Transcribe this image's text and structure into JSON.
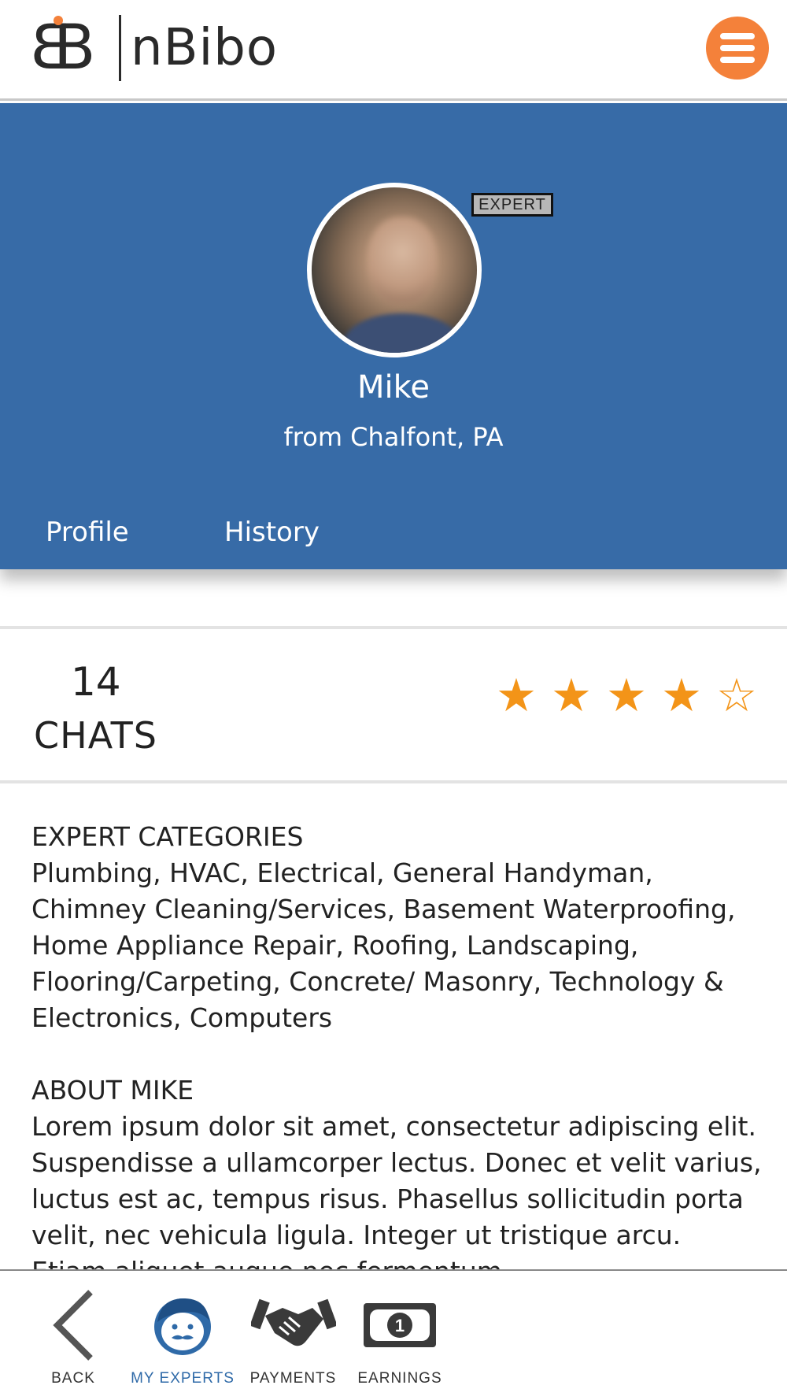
{
  "header": {
    "brand": "nBibo",
    "logo_icon": "bb-logo-icon",
    "menu_icon": "hamburger-menu-icon",
    "accent_color": "#f4813a"
  },
  "profile": {
    "badge": "EXPERT",
    "name": "Mike",
    "location": "from Chalfont, PA",
    "banner_color": "#376ba7",
    "tabs": [
      {
        "label": "Profile"
      },
      {
        "label": "History"
      }
    ]
  },
  "stats": {
    "chats_count": "14",
    "chats_label": "CHATS",
    "rating": 4,
    "rating_max": 5,
    "star_color": "#f39418"
  },
  "sections": [
    {
      "title": "EXPERT CATEGORIES",
      "body": "Plumbing, HVAC, Electrical, General Handyman, Chimney Cleaning/Services, Basement Waterproofing, Home Appliance Repair, Roofing, Landscaping, Flooring/Carpeting, Concrete/ Masonry, Technology & Electronics, Computers"
    },
    {
      "title": "ABOUT MIKE",
      "body": "Lorem ipsum dolor sit amet, consectetur adipiscing elit. Suspendisse a ullamcorper lectus. Donec et velit varius, luctus est ac, tempus risus. Phasellus sollicitudin porta velit, nec vehicula ligula. Integer ut tristique arcu. Etiam aliquet augue nec fermentum"
    }
  ],
  "bottom_nav": {
    "items": [
      {
        "label": "BACK",
        "icon": "chevron-left-icon"
      },
      {
        "label": "MY EXPERTS",
        "icon": "expert-face-icon",
        "active": true
      },
      {
        "label": "PAYMENTS",
        "icon": "handshake-icon"
      },
      {
        "label": "EARNINGS",
        "icon": "banknote-icon"
      }
    ],
    "active_color": "#2f6aa8"
  }
}
